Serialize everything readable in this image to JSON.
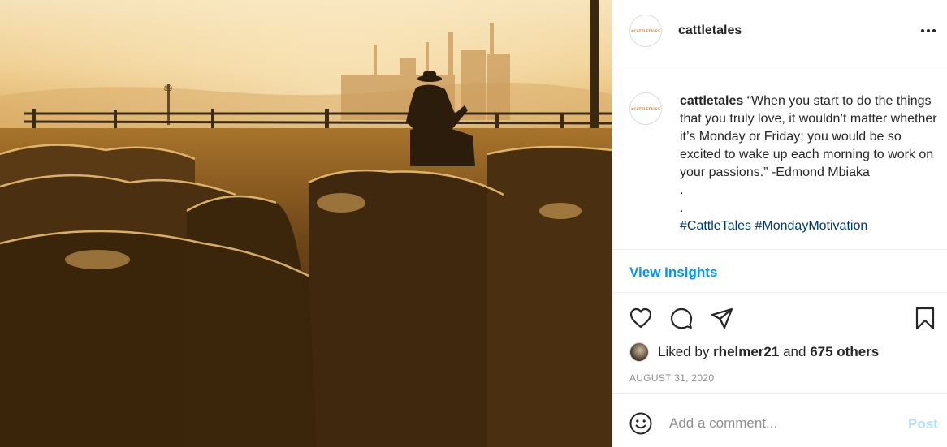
{
  "post": {
    "photo_alt": "",
    "photo_sign_text": "89"
  },
  "header": {
    "logo_text": "#CATTLETALES",
    "username": "cattletales"
  },
  "caption": {
    "username": "cattletales",
    "text": "“When you start to do the things that you truly love, it wouldn’t matter whether it’s Monday or Friday; you would be so excited to wake up each morning to work on your passions.” -Edmond Mbiaka",
    "dot1": ".",
    "dot2": ".",
    "hashtag1": "#CattleTales",
    "hashtag2": "#MondayMotivation"
  },
  "insights": {
    "label": "View Insights"
  },
  "actions": {
    "icons": [
      "heart-icon",
      "comment-icon",
      "share-icon",
      "bookmark-icon"
    ]
  },
  "likes": {
    "prefix": "Liked by",
    "liker": "rhelmer21",
    "middle": "and",
    "others": "675 others"
  },
  "date": "AUGUST 31, 2020",
  "comment": {
    "placeholder": "Add a comment...",
    "post_label": "Post"
  },
  "colors": {
    "link_blue": "#0095f6",
    "post_disabled": "#b2dffc",
    "hashtag": "#00376b",
    "meta_gray": "#8e8e8e"
  }
}
